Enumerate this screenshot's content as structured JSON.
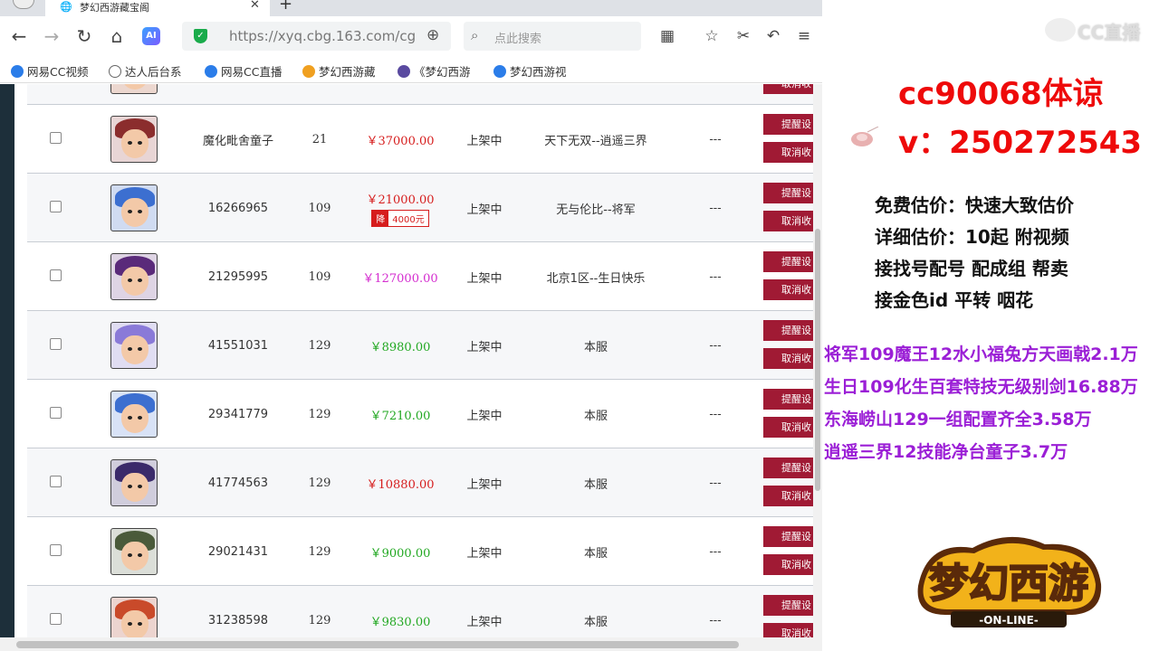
{
  "browser": {
    "tab_title": "梦幻西游藏宝阁",
    "url": "https://xyq.cbg.163.com/cg",
    "search_placeholder": "点此搜索",
    "bookmarks": [
      "网易CC视频",
      "达人后台系",
      "网易CC直播",
      "梦幻西游藏",
      "《梦幻西游",
      "梦幻西游视"
    ]
  },
  "table": {
    "rows": [
      {
        "name": "",
        "level": "",
        "price": "",
        "drop": "",
        "status": "",
        "server": "",
        "dash": "",
        "price_color": "#d61d1d",
        "hair": "#c9582a",
        "partial": true,
        "btn1": "",
        "btn2": "取消收"
      },
      {
        "name": "魔化毗舍童子",
        "level": "21",
        "price": "￥37000.00",
        "drop": "",
        "status": "上架中",
        "server": "天下无双--逍遥三界",
        "dash": "---",
        "price_color": "#d61d1d",
        "hair": "#8b2d2d",
        "btn1": "提醒设",
        "btn2": "取消收"
      },
      {
        "name": "16266965",
        "level": "109",
        "price": "￥21000.00",
        "drop": "4000元",
        "drop_label": "降",
        "status": "上架中",
        "server": "无与伦比--将军",
        "dash": "---",
        "price_color": "#d61d1d",
        "hair": "#3c6fd0",
        "btn1": "提醒设",
        "btn2": "取消收"
      },
      {
        "name": "21295995",
        "level": "109",
        "price": "￥127000.00",
        "drop": "",
        "status": "上架中",
        "server": "北京1区--生日快乐",
        "dash": "---",
        "price_color": "#d42ccf",
        "hair": "#5a2a7a",
        "btn1": "提醒设",
        "btn2": "取消收"
      },
      {
        "name": "41551031",
        "level": "129",
        "price": "￥8980.00",
        "drop": "",
        "status": "上架中",
        "server": "本服",
        "dash": "---",
        "price_color": "#22a822",
        "hair": "#8a7ad8",
        "btn1": "提醒设",
        "btn2": "取消收"
      },
      {
        "name": "29341779",
        "level": "129",
        "price": "￥7210.00",
        "drop": "",
        "status": "上架中",
        "server": "本服",
        "dash": "---",
        "price_color": "#22a822",
        "hair": "#3c6fd0",
        "btn1": "提醒设",
        "btn2": "取消收"
      },
      {
        "name": "41774563",
        "level": "129",
        "price": "￥10880.00",
        "drop": "",
        "status": "上架中",
        "server": "本服",
        "dash": "---",
        "price_color": "#d61d1d",
        "hair": "#3a2a6a",
        "btn1": "提醒设",
        "btn2": "取消收"
      },
      {
        "name": "29021431",
        "level": "129",
        "price": "￥9000.00",
        "drop": "",
        "status": "上架中",
        "server": "本服",
        "dash": "---",
        "price_color": "#22a822",
        "hair": "#4a5a3a",
        "btn1": "提醒设",
        "btn2": "取消收"
      },
      {
        "name": "31238598",
        "level": "129",
        "price": "￥9830.00",
        "drop": "",
        "status": "上架中",
        "server": "本服",
        "dash": "---",
        "price_color": "#22a822",
        "hair": "#c94a2a",
        "btn1": "提醒设",
        "btn2": "取消收"
      }
    ]
  },
  "overlay": {
    "platform_logo": "CC直播",
    "contact_line1": "cc90068体谅",
    "contact_line2": "v：250272543",
    "info_lines": [
      "免费估价：快速大致估价",
      "详细估价：10起  附视频",
      "接找号配号 配成组 帮卖",
      "接金色id 平转 咽花"
    ],
    "promo_lines": [
      "将军109魔王12水小福兔方天画戟2.1万",
      "生日109化生百套特技无级别剑16.88万",
      "东海崂山129一组配置齐全3.58万",
      "逍遥三界12技能净台童子3.7万"
    ],
    "game_logo": "梦幻西游",
    "game_logo_sub": "-ON-LINE-"
  }
}
